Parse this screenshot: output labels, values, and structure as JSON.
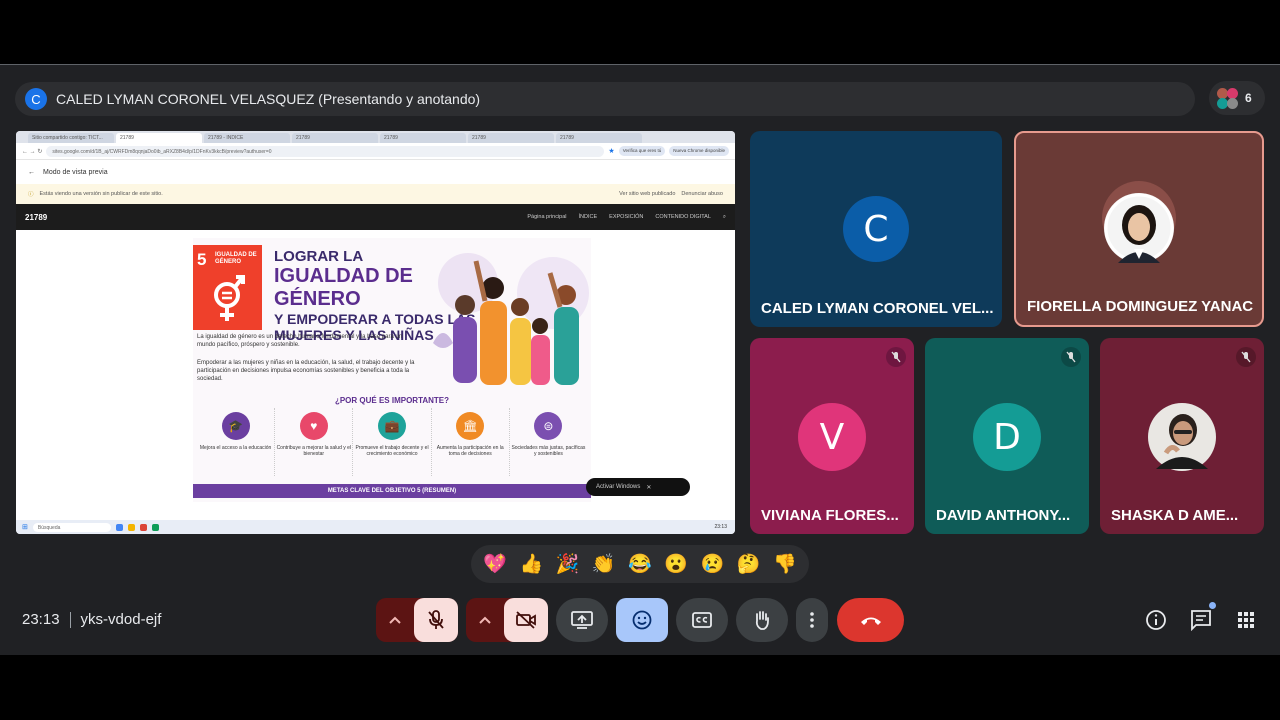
{
  "presenter": {
    "initial": "C",
    "banner": "CALED LYMAN CORONEL VELASQUEZ (Presentando y anotando)"
  },
  "participants_count": "6",
  "screen": {
    "tabs": [
      "Sitio compartido contigo: TICT...",
      "21789",
      "21789 - INDICE",
      "21789",
      "21789",
      "21789",
      "21789"
    ],
    "address": "sites.google.com/d/1B_aj/CWRFDm8qqnjaDo0ib_aRXZ8B4d/p/1DFnKv3kkcB/preview?authuser=0",
    "chip_user": "Verifica que eres tú",
    "chip_chrome": "Nueva Chrome disponible",
    "preview_mode": "Modo de vista previa",
    "notice": "Estás viendo una versión sin publicar de este sitio.",
    "view_published": "Ver sitio web publicado",
    "report_abuse": "Denunciar abuso",
    "site_logo": "21789",
    "nav": [
      "Página principal",
      "ÍNDICE",
      "EXPOSICIÓN",
      "CONTENIDO DIGITAL"
    ],
    "poster": {
      "sdg_number": "5",
      "sdg_label": "IGUALDAD DE GÉNERO",
      "title_1": "LOGRAR LA",
      "title_2": "IGUALDAD DE GÉNERO",
      "title_3": "Y EMPODERAR A TODAS LAS MUJERES Y LAS NIÑAS",
      "p1": "La igualdad de género es un derecho humano fundamental y la base para un mundo pacífico, próspero y sostenible.",
      "p2": "Empoderar a las mujeres y niñas en la educación, la salud, el trabajo decente y la participación en decisiones impulsa economías sostenibles y beneficia a toda la sociedad.",
      "why": "¿POR QUÉ ES IMPORTANTE?",
      "reasons": [
        {
          "text": "Mejora el acceso a la educación",
          "color": "#6b3fa0",
          "icon": "graduation-cap-icon"
        },
        {
          "text": "Contribuye a mejorar la salud y el bienestar",
          "color": "#e8486a",
          "icon": "heart-pulse-icon"
        },
        {
          "text": "Promueve el trabajo decente y el crecimiento económico",
          "color": "#1ea39a",
          "icon": "briefcase-icon"
        },
        {
          "text": "Aumenta la participación en la toma de decisiones",
          "color": "#f08a24",
          "icon": "institution-icon"
        },
        {
          "text": "Sociedades más justas, pacíficas y sostenibles",
          "color": "#7b4fb0",
          "icon": "equality-icon"
        }
      ],
      "goals": "METAS CLAVE DEL OBJETIVO 5 (RESUMEN)"
    },
    "present_pill": "Activar Windows",
    "taskbar_search": "Búsqueda",
    "clock": "23:13"
  },
  "tiles": [
    {
      "name": "CALED LYMAN CORONEL VEL...",
      "initial": "C",
      "bg": "#0e3a5a",
      "avatar_color": "#0b5da8"
    },
    {
      "name": "FIORELLA DOMINGUEZ YANAC",
      "bg": "#6a3a36"
    },
    {
      "name": "VIVIANA FLORES...",
      "initial": "V",
      "bg": "#8c1d4d",
      "avatar_color": "#e0357a"
    },
    {
      "name": "DAVID ANTHONY...",
      "initial": "D",
      "bg": "#0f5c58",
      "avatar_color": "#149c95"
    },
    {
      "name": "SHASKA D AME...",
      "bg": "#6e1f35"
    }
  ],
  "reactions": [
    "💖",
    "👍",
    "🎉",
    "👏",
    "😂",
    "😮",
    "😢",
    "🤔",
    "👎"
  ],
  "meeting": {
    "time": "23:13",
    "code": "yks-vdod-ejf"
  }
}
